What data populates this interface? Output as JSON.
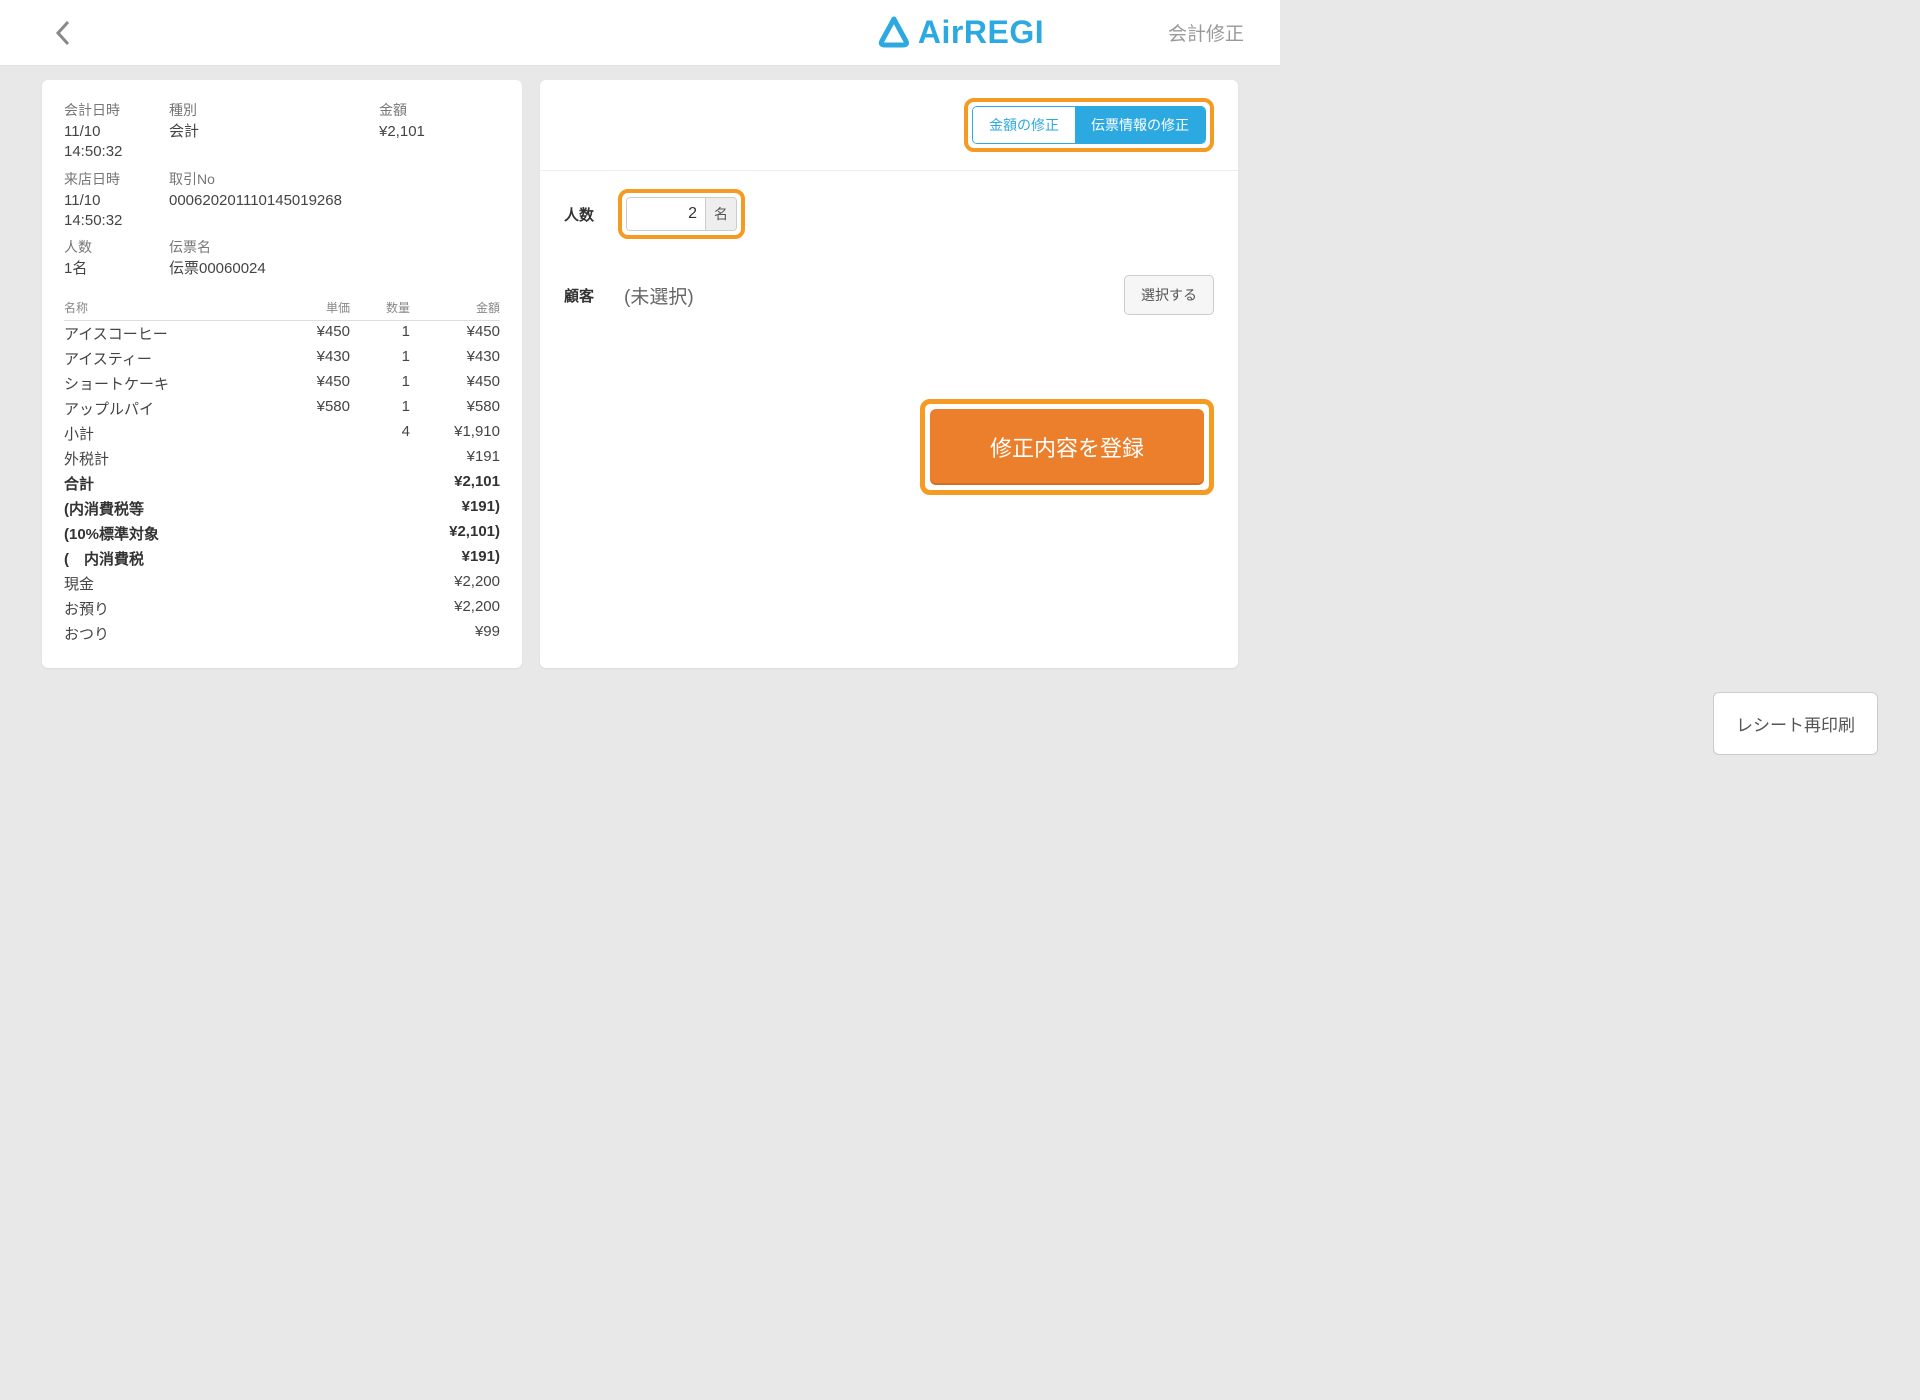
{
  "header": {
    "logo_text": "AirREGI",
    "right_label": "会計修正"
  },
  "info": {
    "labels": {
      "datetime": "会計日時",
      "type": "種別",
      "amount": "金額",
      "visit": "来店日時",
      "txno": "取引No",
      "people": "人数",
      "slip": "伝票名"
    },
    "datetime": "11/10 14:50:32",
    "type": "会計",
    "amount": "¥2,101",
    "visit": "11/10 14:50:32",
    "txno": "00062020111014501​9268",
    "people": "1名",
    "slip": "伝票00060024"
  },
  "items_head": {
    "name": "名称",
    "unit": "単価",
    "qty": "数量",
    "amount": "金額"
  },
  "items": [
    {
      "name": "アイスコーヒー",
      "unit": "¥450",
      "qty": "1",
      "amount": "¥450"
    },
    {
      "name": "アイスティー",
      "unit": "¥430",
      "qty": "1",
      "amount": "¥430"
    },
    {
      "name": "ショートケーキ",
      "unit": "¥450",
      "qty": "1",
      "amount": "¥450"
    },
    {
      "name": "アップルパイ",
      "unit": "¥580",
      "qty": "1",
      "amount": "¥580"
    }
  ],
  "sums": [
    {
      "name": "小計",
      "unit": "",
      "qty": "4",
      "amount": "¥1,910",
      "bold": false
    },
    {
      "name": "外税計",
      "unit": "",
      "qty": "",
      "amount": "¥191",
      "bold": false
    },
    {
      "name": "合計",
      "unit": "",
      "qty": "",
      "amount": "¥2,101",
      "bold": true
    },
    {
      "name": "(内消費税等",
      "unit": "",
      "qty": "",
      "amount": "¥191)",
      "bold": true
    },
    {
      "name": "(10%標準対象",
      "unit": "",
      "qty": "",
      "amount": "¥2,101)",
      "bold": true
    },
    {
      "name": "(　内消費税",
      "unit": "",
      "qty": "",
      "amount": "¥191)",
      "bold": true
    },
    {
      "name": "現金",
      "unit": "",
      "qty": "",
      "amount": "¥2,200",
      "bold": false
    },
    {
      "name": "お預り",
      "unit": "",
      "qty": "",
      "amount": "¥2,200",
      "bold": false
    },
    {
      "name": "おつり",
      "unit": "",
      "qty": "",
      "amount": "¥99",
      "bold": false
    }
  ],
  "right": {
    "seg": {
      "left": "金額の修正",
      "right": "伝票情報の修正"
    },
    "people_label": "人数",
    "people_value": "2",
    "people_unit": "名",
    "customer_label": "顧客",
    "customer_value": "(未選択)",
    "select_btn": "選択する",
    "submit_btn": "修正内容を登録"
  },
  "reprint_btn": "レシート再印刷"
}
